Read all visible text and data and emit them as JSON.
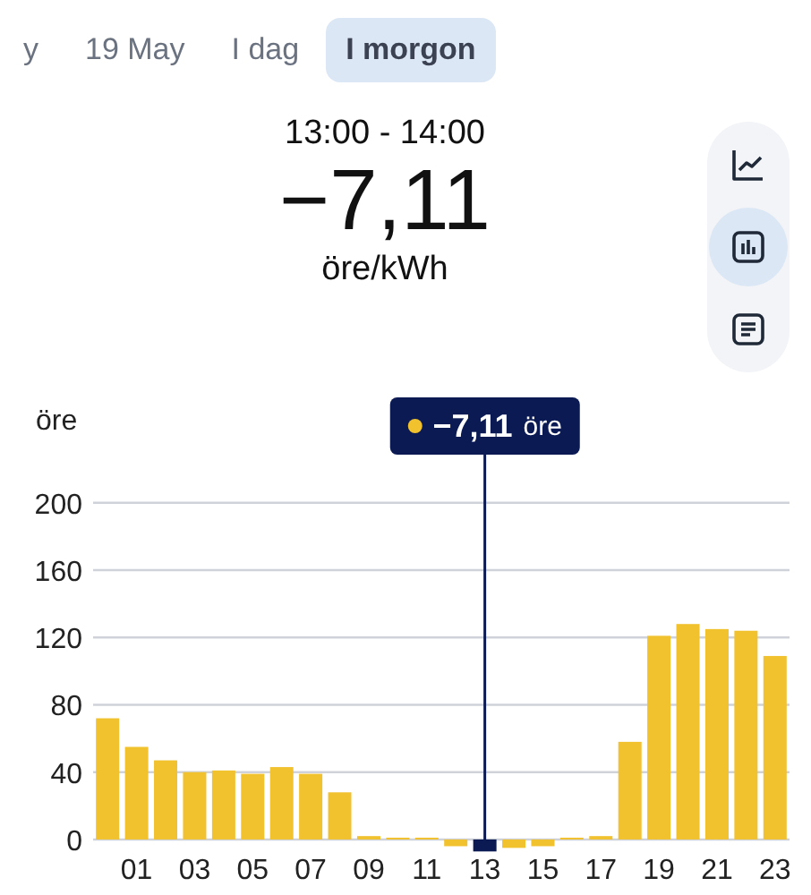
{
  "tabs": [
    {
      "label": "y",
      "selected": false
    },
    {
      "label": "19 May",
      "selected": false
    },
    {
      "label": "I dag",
      "selected": false
    },
    {
      "label": "I morgon",
      "selected": true
    }
  ],
  "summary": {
    "time_range": "13:00 - 14:00",
    "price": "−7,11",
    "unit": "öre/kWh"
  },
  "view_buttons": [
    {
      "kind": "line",
      "selected": false
    },
    {
      "kind": "bar",
      "selected": true
    },
    {
      "kind": "list",
      "selected": false
    }
  ],
  "chart": {
    "chart_data": {
      "type": "bar",
      "ylabel": "öre",
      "x": [
        0,
        1,
        2,
        3,
        4,
        5,
        6,
        7,
        8,
        9,
        10,
        11,
        12,
        13,
        14,
        15,
        16,
        17,
        18,
        19,
        20,
        21,
        22,
        23
      ],
      "values": [
        72,
        55,
        47,
        40,
        41,
        39,
        43,
        39,
        28,
        2,
        0,
        0,
        -4,
        -7.11,
        -5,
        -4,
        0,
        2,
        58,
        121,
        128,
        125,
        124,
        109
      ],
      "xlim": [
        -0.5,
        23.5
      ],
      "ylim": [
        -8,
        200
      ],
      "grid": true,
      "yticks": [
        0,
        40,
        80,
        120,
        160,
        200
      ],
      "xticks": [
        {
          "value": 1,
          "label": "01"
        },
        {
          "value": 3,
          "label": "03"
        },
        {
          "value": 5,
          "label": "05"
        },
        {
          "value": 7,
          "label": "07"
        },
        {
          "value": 9,
          "label": "09"
        },
        {
          "value": 11,
          "label": "11"
        },
        {
          "value": 13,
          "label": "13"
        },
        {
          "value": 15,
          "label": "15"
        },
        {
          "value": 17,
          "label": "17"
        },
        {
          "value": 19,
          "label": "19"
        },
        {
          "value": 21,
          "label": "21"
        },
        {
          "value": 23,
          "label": "23"
        }
      ],
      "ref_lines": [
        {
          "axis": "x",
          "value": 13
        }
      ]
    },
    "tooltip": {
      "value": "−7,11",
      "unit": "öre"
    }
  }
}
